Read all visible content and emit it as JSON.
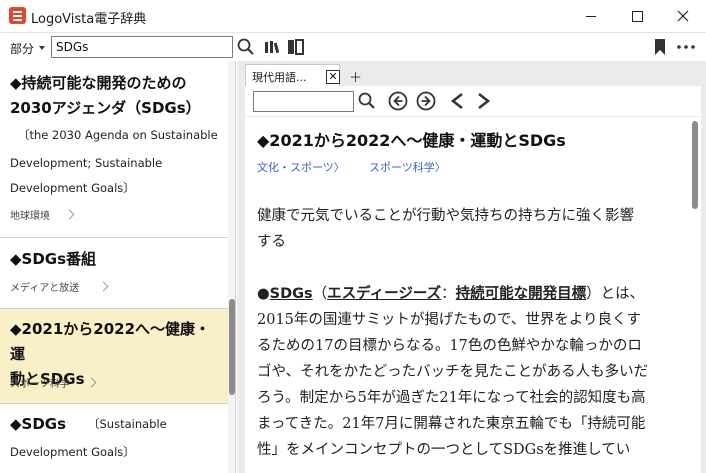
{
  "window": {
    "title": "LogoVista電子辞典"
  },
  "toolbar": {
    "mode_label": "部分",
    "search_value": "SDGs"
  },
  "results": [
    {
      "head_line1": "◆持続可能な開発のための",
      "head_line2": "2030アジェンダ（SDGs）",
      "sub_line1": "〔the 2030 Agenda on Sustainable",
      "sub_line2": "Development; Sustainable",
      "sub_line3": "Development Goals〕",
      "tag": "地球環境"
    },
    {
      "head_line1": "◆SDGs番組",
      "tag": "メディアと放送"
    },
    {
      "head_line1": "◆2021から2022へ～健康・運",
      "head_line2": "動とSDGs",
      "tag": "スポーツ科学"
    },
    {
      "head_line1": "◆SDGs",
      "sub_inline": "〔Sustainable",
      "sub_line2": "Development Goals〕"
    }
  ],
  "tabs": {
    "active_label": "現代用語...",
    "close_symbol": "✕",
    "add_symbol": "＋"
  },
  "article": {
    "title": "◆2021から2022へ～健康・運動とSDGs",
    "crumb1": "文化・スポーツ〉",
    "crumb2": "スポーツ科学〉",
    "lead_line1": "健康で元気でいることが行動や気持ちの持ち方に強く影響",
    "lead_line2": "する",
    "bullet": "●",
    "kw1": "SDGs",
    "paren_open": "（",
    "kw2": "エスディージーズ",
    "colon": "：",
    "kw3": "持続可能な開発目標",
    "after_kw": "）とは、",
    "line2": "2015年の国連サミットが掲げたもので、世界をより良くす",
    "line3": "るための17の目標からなる。17色の色鮮やかな輪っかのロ",
    "line4": "ゴや、それをかたどったバッチを見たことがある人も多いだ",
    "line5": "ろう。制定から5年が過ぎた21年になって社会的認知度も高",
    "line6": "まってきた。21年7月に開幕された東京五輪でも「持続可能",
    "line7": "性」をメインコンセプトの一つとしてSDGsを推進してい"
  },
  "icons": {
    "app": "dictionary-app-icon",
    "search": "search-icon",
    "books": "books-icon",
    "panels": "panel-layout-icon",
    "bookmark": "bookmark-icon",
    "more": "more-icon",
    "prev_hit": "previous-hit-icon",
    "next_hit": "next-hit-icon",
    "back": "back-icon",
    "forward": "forward-icon"
  }
}
